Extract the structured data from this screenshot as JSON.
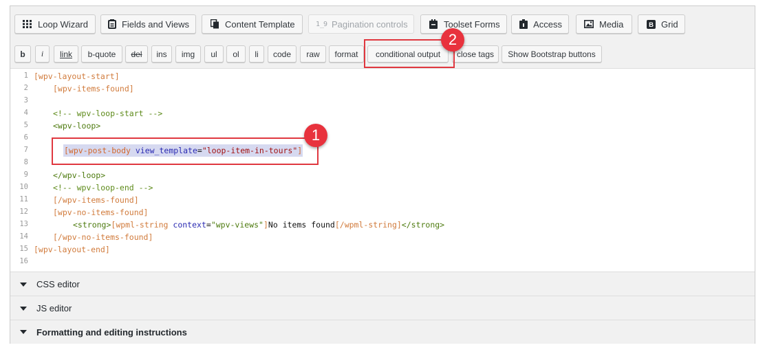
{
  "toolbar": {
    "buttons": [
      {
        "label": "Loop Wizard",
        "icon": "grid-list-icon",
        "disabled": false
      },
      {
        "label": "Fields and Views",
        "icon": "fields-icon",
        "disabled": false
      },
      {
        "label": "Content Template",
        "icon": "content-template-icon",
        "disabled": false
      },
      {
        "label": "Pagination controls",
        "icon": "pagination-icon",
        "disabled": true
      },
      {
        "label": "Toolset Forms",
        "icon": "forms-icon",
        "disabled": false
      },
      {
        "label": "Access",
        "icon": "lock-icon",
        "disabled": false
      },
      {
        "label": "Media",
        "icon": "media-icon",
        "disabled": false
      },
      {
        "label": "Grid",
        "icon": "bootstrap-icon",
        "disabled": false
      }
    ]
  },
  "quicktags": [
    "b",
    "i",
    "link",
    "b-quote",
    "del",
    "ins",
    "img",
    "ul",
    "ol",
    "li",
    "code",
    "raw",
    "format",
    "conditional output",
    "close tags",
    "Show Bootstrap buttons"
  ],
  "editor": {
    "line_numbers": [
      "1",
      "2",
      "3",
      "4",
      "5",
      "6",
      "7",
      "8",
      "9",
      "10",
      "11",
      "12",
      "13",
      "14",
      "15",
      "16"
    ],
    "lines": {
      "l1": "[wpv-layout-start]",
      "l2": "[wpv-items-found]",
      "l4": "<!-- wpv-loop-start -->",
      "l5": "<wpv-loop>",
      "l7_open": "[wpv-post-body ",
      "l7_attr": "view_template",
      "l7_eq": "=",
      "l7_str": "\"loop-item-in-tours\"",
      "l7_close": "]",
      "l9": "</wpv-loop>",
      "l10": "<!-- wpv-loop-end -->",
      "l11": "[/wpv-items-found]",
      "l12": "[wpv-no-items-found]",
      "l13_tag_open": "<strong>",
      "l13_sc_open": "[wpml-string ",
      "l13_attr": "context",
      "l13_eq": "=",
      "l13_str": "\"wpv-views\"",
      "l13_sc_end": "]",
      "l13_text": "No items found",
      "l13_sc_close": "[/wpml-string]",
      "l13_tag_close": "</strong>",
      "l14": "[/wpv-no-items-found]",
      "l15": "[wpv-layout-end]"
    }
  },
  "annotations": {
    "badge1": "1",
    "badge2": "2"
  },
  "sections": {
    "css": "CSS editor",
    "js": "JS editor",
    "formatting": "Formatting and editing instructions"
  },
  "colors": {
    "highlight": "#e0373f",
    "badge": "#e8323d",
    "shortcode": "#d17b3c",
    "html_tag": "#4d7a0e",
    "attribute": "#2a2ab2",
    "string": "#a11111",
    "selection": "#d6d9f0"
  }
}
